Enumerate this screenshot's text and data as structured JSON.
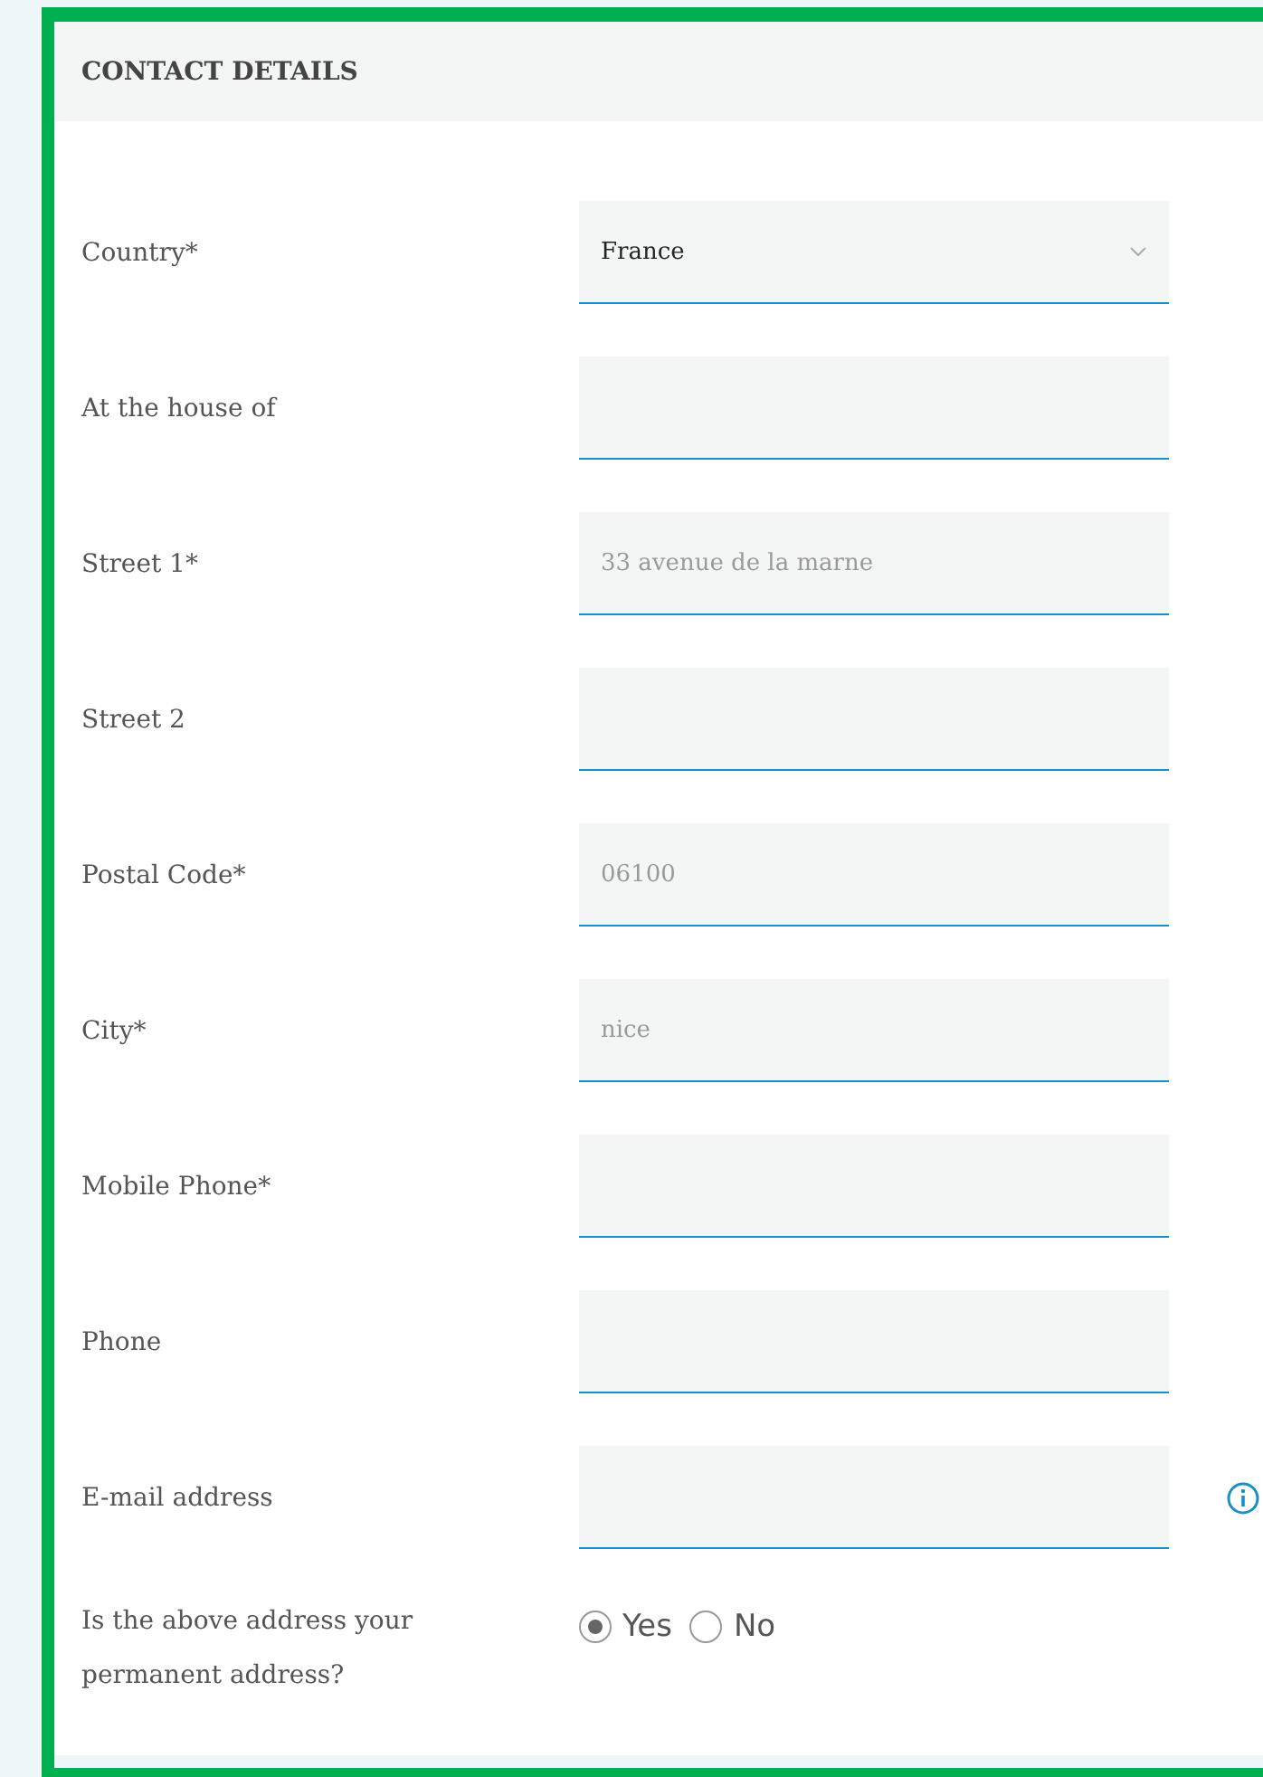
{
  "section": {
    "title": "CONTACT DETAILS"
  },
  "fields": [
    {
      "label": "Country*",
      "kind": "select",
      "value": "France"
    },
    {
      "label": "At the house of",
      "kind": "text"
    },
    {
      "label": "Street 1*",
      "kind": "text",
      "placeholder": "33 avenue de la marne"
    },
    {
      "label": "Street 2",
      "kind": "text"
    },
    {
      "label": "Postal Code*",
      "kind": "text",
      "placeholder": "06100"
    },
    {
      "label": "City*",
      "kind": "text",
      "placeholder": "nice"
    },
    {
      "label": "Mobile Phone*",
      "kind": "text"
    },
    {
      "label": "Phone",
      "kind": "text"
    },
    {
      "label": "E-mail address",
      "kind": "text",
      "info": true
    }
  ],
  "permanent": {
    "label": "Is the above address your permanent address?",
    "options": [
      {
        "label": "Yes",
        "selected": true
      },
      {
        "label": "No",
        "selected": false
      }
    ]
  }
}
